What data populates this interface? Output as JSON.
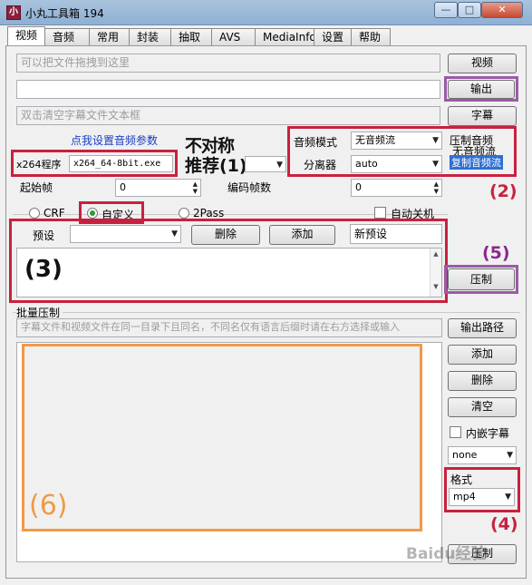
{
  "window": {
    "title": "小丸工具箱 194",
    "icon_label": "小"
  },
  "tabs": [
    "视频",
    "音频",
    "常用",
    "封装",
    "抽取",
    "AVS",
    "MediaInfo",
    "设置",
    "帮助"
  ],
  "video": {
    "drag_hint": "可以把文件拖拽到这里",
    "output_value": "",
    "subtitle_hint": "双击清空字幕文件文本框",
    "btn_video": "视频",
    "btn_output": "输出",
    "btn_subtitle": "字幕",
    "audio_params_link": "点我设置音频参数",
    "x264_label": "x264程序",
    "x264_value": "x264_64-8bit.exe",
    "overlay_asym": "不对称",
    "overlay_recommend": "推荐(1)",
    "audio_mode_label": "音频模式",
    "audio_mode_value": "无音频流",
    "splitter_label": "分离器",
    "splitter_value": "auto",
    "compress_audio_label": "压制音频",
    "no_audio_label": "无音频流",
    "copy_audio_label": "复制音频流",
    "start_frame_label": "起始帧",
    "start_frame_value": "0",
    "encode_frames_label": "编码帧数",
    "encode_frames_value": "0",
    "mode_crf": "CRF",
    "mode_custom": "自定义",
    "mode_2pass": "2Pass",
    "auto_shutdown": "自动关机",
    "preset_label": "预设",
    "preset_value": "",
    "btn_delete": "删除",
    "btn_add": "添加",
    "new_preset": "新预设",
    "btn_compress": "压制"
  },
  "batch": {
    "label": "批量压制",
    "hint": "字幕文件和视频文件在同一目录下且同名，不同名仅有语言后缀时请在右方选择或输入",
    "btn_output_path": "输出路径",
    "btn_add": "添加",
    "btn_delete": "删除",
    "btn_clear": "清空",
    "embed_subtitle": "内嵌字幕",
    "lang_value": "none",
    "format_label": "格式",
    "format_value": "mp4",
    "btn_compress": "压制"
  },
  "annotations": {
    "a2": "(2)",
    "a3": "(3)",
    "a4": "(4)",
    "a5": "(5)",
    "a6": "(6)"
  },
  "watermark": "Baidu经验",
  "colors": {
    "annotation_red": "#c8213f",
    "annotation_purple": "#9b5aa8",
    "annotation_orange": "#f09a45",
    "link_blue": "#1a3fc6"
  }
}
